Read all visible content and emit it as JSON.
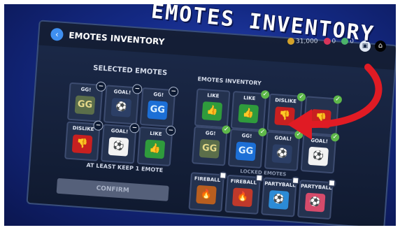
{
  "banner": {
    "title": "EMOTES INVENTORY"
  },
  "header": {
    "title": "EMOTES INVENTORY"
  },
  "currency": {
    "coins": "31,000",
    "gems": "0",
    "tokens": "0"
  },
  "selected": {
    "title": "SELECTED EMOTES",
    "items": [
      {
        "label": "GG!"
      },
      {
        "label": "GOAL!"
      },
      {
        "label": "GG!"
      },
      {
        "label": "DISLIKE"
      },
      {
        "label": "GOAL!"
      },
      {
        "label": "LIKE"
      }
    ],
    "keep_text": "AT LEAST KEEP 1 EMOTE",
    "confirm_label": "CONFIRM"
  },
  "inventory": {
    "title": "EMOTES INVENTORY",
    "items": [
      {
        "label": "LIKE"
      },
      {
        "label": "LIKE"
      },
      {
        "label": "DISLIKE"
      },
      {
        "label": ""
      },
      {
        "label": "GG!"
      },
      {
        "label": "GG!"
      },
      {
        "label": "GOAL!"
      },
      {
        "label": "GOAL!"
      }
    ]
  },
  "locked": {
    "title": "LOCKED EMOTES",
    "items": [
      {
        "label": "FIREBALL"
      },
      {
        "label": "FIREBALL"
      },
      {
        "label": "PARTYBALL"
      },
      {
        "label": "PARTYBALL"
      }
    ]
  },
  "colors": {
    "accent": "#3f8ff0",
    "check": "#5eb84a",
    "arrow": "#e01b24"
  }
}
